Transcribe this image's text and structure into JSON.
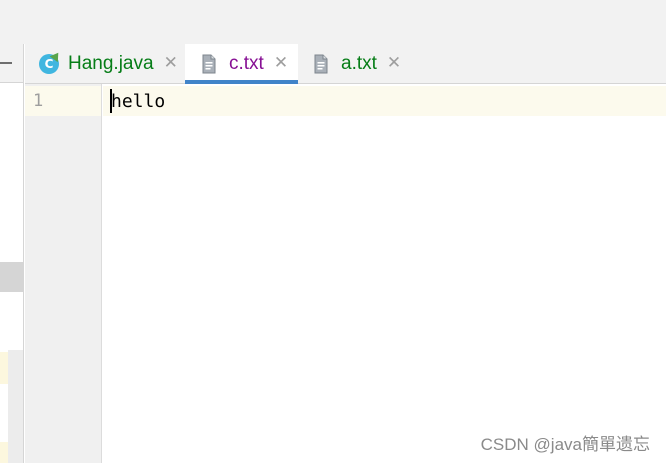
{
  "tabs": [
    {
      "label": "Hang.java",
      "icon": "java-class-icon",
      "color": "#067d17",
      "active": false
    },
    {
      "label": "c.txt",
      "icon": "text-file-icon",
      "color": "#871094",
      "active": true
    },
    {
      "label": "a.txt",
      "icon": "text-file-icon",
      "color": "#067d17",
      "active": false
    }
  ],
  "close_glyph": "✕",
  "class_icon_letter": "C",
  "editor": {
    "line_numbers": [
      "1"
    ],
    "lines": [
      "hello"
    ]
  },
  "watermark": "CSDN @java簡單遗忘",
  "colors": {
    "active_tab_underline": "#4083c9",
    "current_line_highlight": "#fcfaed",
    "tab_bar_background": "#f2f2f2"
  }
}
